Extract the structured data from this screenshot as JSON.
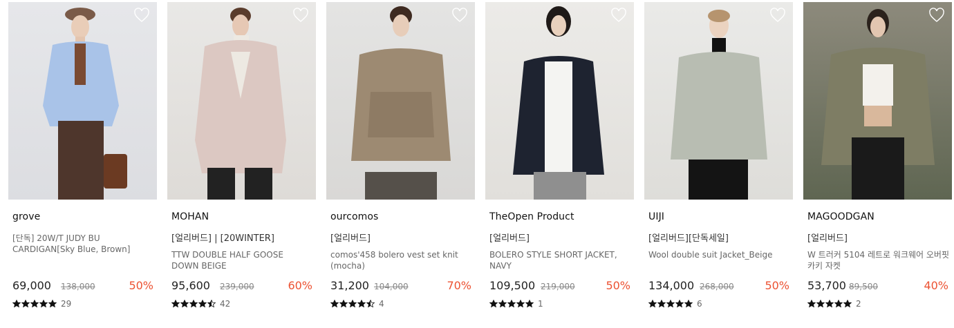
{
  "colors": {
    "discount": "#ec5232",
    "heart_outline": "#ffffff",
    "star": "#111111"
  },
  "products": [
    {
      "brand": "grove",
      "tag": "",
      "name": "[단독] 20W/T JUDY BU CARDIGAN[Sky Blue, Brown]",
      "price": "69,000",
      "original_price": "138,000",
      "discount": "50%",
      "rating": 5,
      "review_count": "29",
      "image": "model in sky blue cardigan and brown beret",
      "icon": "heart-outline-icon"
    },
    {
      "brand": "MOHAN",
      "tag": "[얼리버드] | [20WINTER]",
      "name": "TTW DOUBLE HALF GOOSE DOWN BEIGE",
      "price": "95,600",
      "original_price": "239,000",
      "discount": "60%",
      "rating": 4.5,
      "review_count": "42",
      "image": "model in beige puffer goose down jacket",
      "icon": "heart-outline-icon"
    },
    {
      "brand": "ourcomos",
      "tag": "[얼리버드]",
      "name": "comos'458 bolero vest set knit (mocha)",
      "price": "31,200",
      "original_price": "104,000",
      "discount": "70%",
      "rating": 4.5,
      "review_count": "4",
      "image": "model in mocha bolero vest knit set",
      "icon": "heart-outline-icon"
    },
    {
      "brand": "TheOpen Product",
      "tag": "[얼리버드]",
      "name": "BOLERO STYLE SHORT JACKET, NAVY",
      "price": "109,500",
      "original_price": "219,000",
      "discount": "50%",
      "rating": 5,
      "review_count": "1",
      "image": "model in navy short bolero jacket over white tee",
      "icon": "heart-outline-icon"
    },
    {
      "brand": "UIJI",
      "tag": "[얼리버드][단독세일]",
      "name": "Wool double suit Jacket_Beige",
      "price": "134,000",
      "original_price": "268,000",
      "discount": "50%",
      "rating": 5,
      "review_count": "6",
      "image": "model in beige double suit jacket",
      "icon": "heart-outline-icon"
    },
    {
      "brand": "MAGOODGAN",
      "tag": "[얼리버드]",
      "name": "W 트러커 5104 레트로 워크웨어 오버핏 카키 자켓",
      "price": "53,700",
      "original_price": "89,500",
      "discount": "40%",
      "rating": 5,
      "review_count": "2",
      "image": "model in khaki overfit trucker jacket",
      "icon": "heart-outline-icon"
    }
  ]
}
